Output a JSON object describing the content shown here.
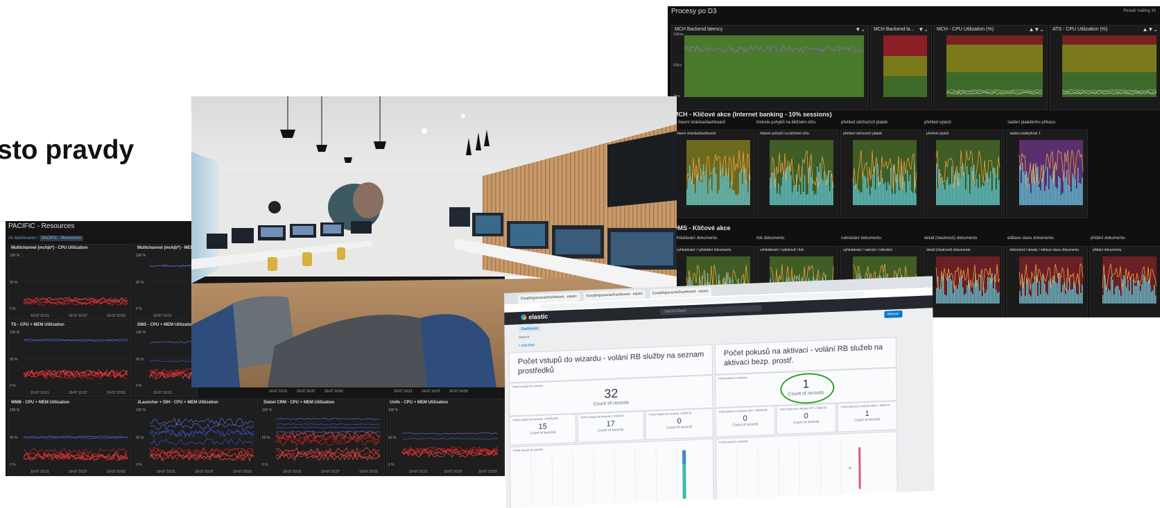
{
  "headline": "sto pravdy",
  "resources": {
    "title": "PACIFIC - Resources",
    "breadcrumb_home": "All dashboards",
    "breadcrumb_current": "PACIFIC - Resources",
    "panels": [
      {
        "title": "Multichannel (mchjb*) - CPU Utilization"
      },
      {
        "title": "Multichannel (mchjb*) - MEM"
      },
      {
        "title": "TS - CPU + MEM Utilization"
      },
      {
        "title": "DMS - CPU + MEM Utilization"
      },
      {
        "title": "WMB - CPU + MEM Utilization"
      },
      {
        "title": "JLauncher + DIH - CPU + MEM Utilization"
      },
      {
        "title": "Siebel CRM - CPU + MEM Utilization"
      },
      {
        "title": "Unife - CPU + MEM Utilization"
      }
    ],
    "y_ticks": [
      "100 %",
      "50 %",
      "0 %"
    ],
    "x_ticks": [
      "10-07 10:21",
      "10-07 10:37",
      "10-07 10:53"
    ]
  },
  "dashboard": {
    "title": "Procesy po D3",
    "top_right": "Period: trailing 1h",
    "top_panels": [
      {
        "title": "MCH Backend latency"
      },
      {
        "title": "MCH Backend la..."
      },
      {
        "title": "MCH - CPU Utilization (%)"
      },
      {
        "title": "ATS - CPU Utilization (%)"
      }
    ],
    "section_ib": "MCH - Klíčové akce (Internet banking - 10% sessions)",
    "ib_groups": [
      "IB hlavní stránka/dashboard",
      "historie pohybů na běžném účtu",
      "přehled odchozích plateb",
      "přehled výpisů",
      "zadání platebního příkazu"
    ],
    "ib_panels": [
      "hlavní stránka/dashboard",
      "historie pohybů na běžném účtu",
      "přehled odchozích plateb",
      "přehled výpisů",
      "zadání platby/krok 1"
    ],
    "section_dms": "DMS - Klíčové akce",
    "dms_groups": [
      "vyhledávání dokumentu",
      "tisk dokumentu",
      "nahrávání dokumentu",
      "detail (vlastnosti) dokumentu",
      "editace stavu dokumentu",
      "přidání dokumentu"
    ],
    "dms_panels": [
      "vyhledávání / vyhledání dokumentu",
      "vyhledávání / vytisknutí / tisk",
      "vyhledávání / nahrání / odeslání",
      "detail (vlastnosti) dokumentu",
      "dokument / detaily / editace stavu dokumentu",
      "přidání dokumentu"
    ]
  },
  "kibana": {
    "tabs": [
      "EasyBAjpovanie/Dashboard - elastic",
      "EasyBAjpovanie/Dashboard - elastic",
      "EasyBAjpovanie/Dashboard - elastic"
    ],
    "search_placeholder": "Search Elastic",
    "brand": "elastic",
    "panel_left_title": "Počet vstupů do wizardu - volání RB služby na seznam prostředků",
    "panel_right_title": "Počet pokusů na aktivaci - volání RB služeb na aktivaci bezp. prostř.",
    "count_label": "Count of records",
    "refresh": "Refresh",
    "left_big": "32",
    "right_big": "1",
    "left_small": [
      "15",
      "17",
      "0"
    ],
    "right_small": [
      "0",
      "0",
      "1"
    ],
    "left_small_labels": [
      "Počet vstupů do wizardu z WEBU/IB",
      "Počet vstupů do wizardu z Mobil IB",
      "Počet vstupů do wizardu z DMS IB"
    ],
    "right_small_labels": [
      "Počet pokusů o aktivaci MT z WEBU/IB",
      "Počet pokusů o aktivaci MT z Mobil IB",
      "Počet pokusů o aktivaci MBK z Mobil IB"
    ],
    "chart_left_label": "Počet vstupů do wizardu",
    "chart_right_label": "Počet pokusů o aktivaci",
    "left_sub_label": "Počet vstupů do wizardu",
    "right_sub_label": "Počet pokusů o aktivaci",
    "add_filter": "+ Add filter",
    "search_bar": "Search",
    "breadcrumb": "Dashboard",
    "highlight_color": "#2ca02c"
  }
}
